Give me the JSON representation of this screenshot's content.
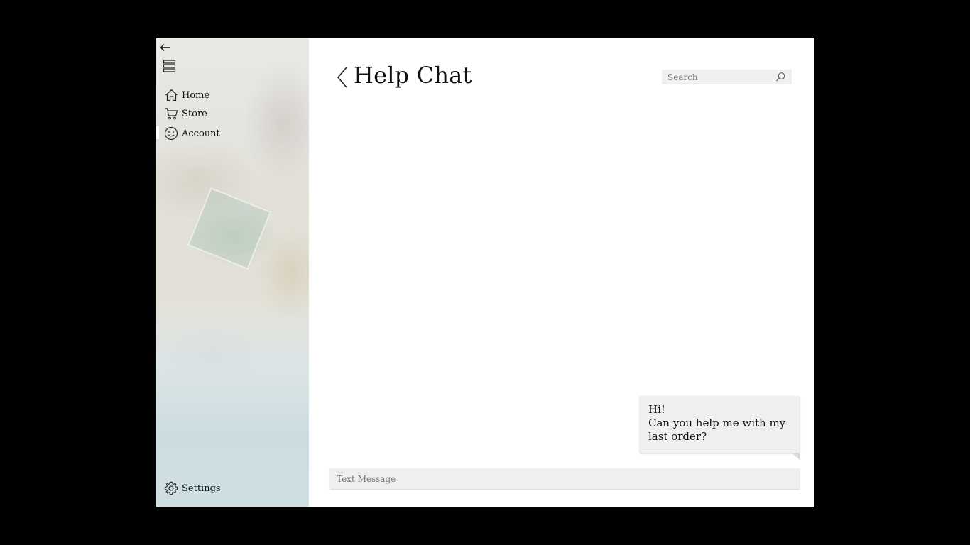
{
  "app": {
    "title": "Help Chat"
  },
  "sidebar": {
    "items": [
      {
        "label": "Home",
        "icon": "home-icon"
      },
      {
        "label": "Store",
        "icon": "cart-icon"
      },
      {
        "label": "Account",
        "icon": "smiley-icon",
        "active": true
      }
    ],
    "settings_label": "Settings",
    "settings_icon": "gear-icon",
    "top_icons": [
      "back-arrow-icon",
      "hamburger-icon"
    ]
  },
  "search": {
    "placeholder": "Search",
    "value": ""
  },
  "chat": {
    "messages": [
      {
        "sender": "user",
        "lines": [
          "Hi!",
          "Can you help me with my",
          "last order?"
        ]
      }
    ],
    "input_placeholder": "Text Message",
    "input_value": ""
  },
  "colors": {
    "background": "#000000",
    "panel": "#ffffff",
    "bubble": "#efefef",
    "input_bg": "#efefef",
    "text": "#111111"
  }
}
